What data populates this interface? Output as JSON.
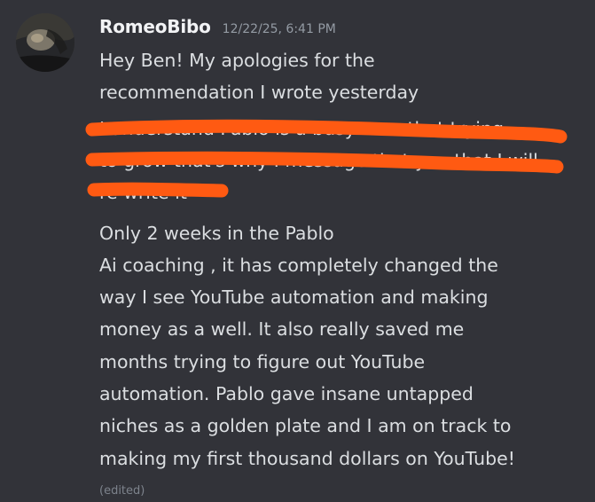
{
  "message": {
    "username": "RomeoBibo",
    "timestamp": "12/22/25, 6:41 PM",
    "lines": [
      "Hey Ben!  My apologies for the",
      "recommendation I wrote yesterday"
    ],
    "redacted_lines": [
      "I understand Pablo is a busy man that trying",
      "to grow that's why I message that you that I will",
      "re write it"
    ],
    "body_lines": [
      "Only 2 weeks in the Pablo",
      "Ai coaching , it has completely changed the",
      "way I see YouTube automation and making",
      "money as a well.  It  also really saved me",
      "months trying to figure out YouTube",
      "automation. Pablo gave insane untapped",
      "niches as a golden plate and I am on track to",
      "making my first thousand dollars on YouTube!"
    ],
    "edited_label": "(edited)"
  },
  "colors": {
    "background": "#323339",
    "username": "#f2f3f5",
    "text": "#dbdee1",
    "timestamp": "#949ba4",
    "redaction": "#ff5a12"
  }
}
